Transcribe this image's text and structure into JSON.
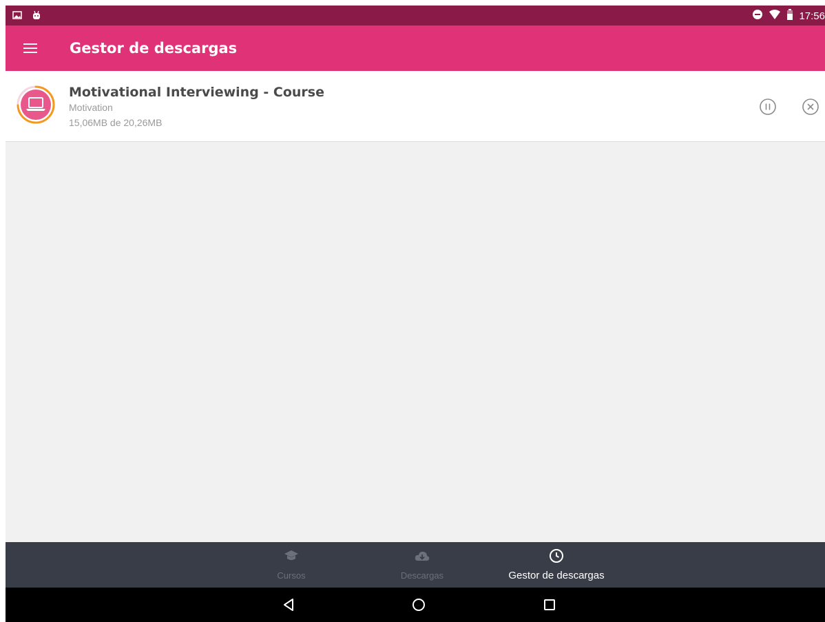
{
  "status_bar": {
    "time": "17:56",
    "left_icons": [
      "image-notification-icon",
      "android-notification-icon"
    ],
    "right_icons": [
      "do-not-disturb-icon",
      "wifi-icon",
      "battery-icon"
    ]
  },
  "app_bar": {
    "title": "Gestor de descargas",
    "menu_icon": "menu-icon"
  },
  "downloads": [
    {
      "title": "Motivational Interviewing - Course",
      "category": "Motivation",
      "size_text": "15,06MB de 20,26MB",
      "progress": 0.743,
      "icon": "laptop-icon",
      "actions": [
        "pause-icon",
        "cancel-icon"
      ]
    }
  ],
  "bottom_nav": {
    "items": [
      {
        "label": "Cursos",
        "icon": "graduation-cap-icon",
        "active": false
      },
      {
        "label": "Descargas",
        "icon": "cloud-download-icon",
        "active": false
      },
      {
        "label": "Gestor de descargas",
        "icon": "clock-icon",
        "active": true
      }
    ]
  },
  "system_nav": [
    "back-icon",
    "home-icon",
    "recents-icon"
  ],
  "colors": {
    "status_bar": "#8a1a47",
    "app_bar": "#e03277",
    "progress_ring": "#f39a1e",
    "icon_fill": "#e8588a",
    "bottom_nav": "#383d47",
    "background": "#f1f1f1"
  }
}
